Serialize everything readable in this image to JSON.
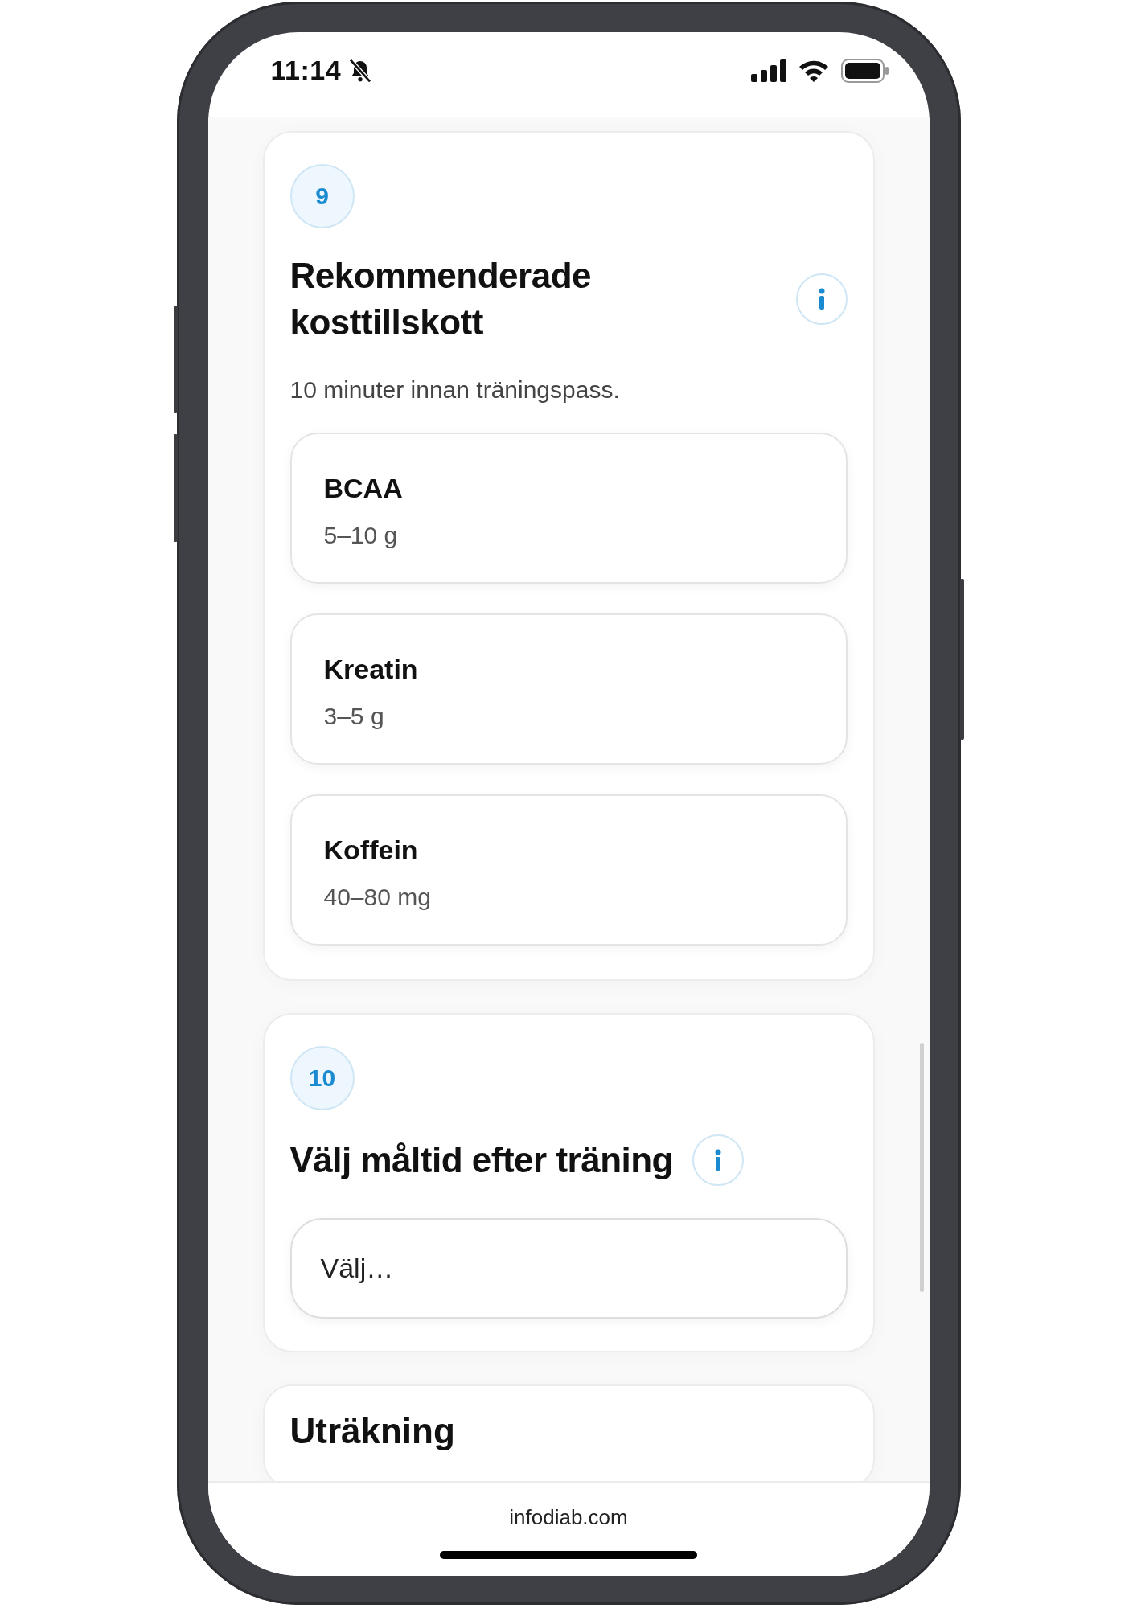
{
  "status_bar": {
    "time": "11:14",
    "silent": true
  },
  "sections": [
    {
      "kind": "list",
      "number": "9",
      "title": "Rekommenderade kosttillskott",
      "info": true,
      "subtitle": "10 minuter innan träningspass.",
      "items": [
        {
          "name": "BCAA",
          "amount": "5–10 g"
        },
        {
          "name": "Kreatin",
          "amount": "3–5 g"
        },
        {
          "name": "Koffein",
          "amount": "40–80 mg"
        }
      ]
    },
    {
      "kind": "select",
      "number": "10",
      "title": "Välj måltid efter träning",
      "info": true,
      "placeholder": "Välj…"
    },
    {
      "kind": "heading",
      "title": "Uträkning"
    }
  ],
  "footer": {
    "url": "infodiab.com"
  }
}
